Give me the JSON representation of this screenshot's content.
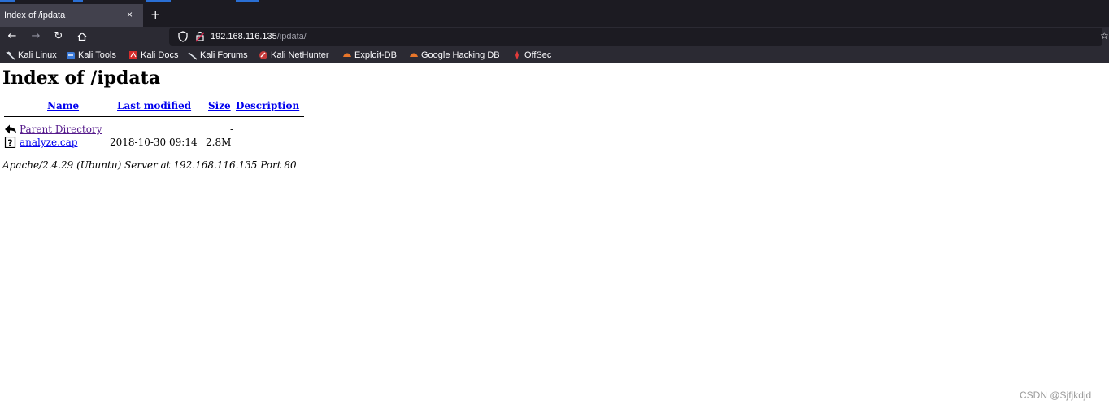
{
  "browser": {
    "tab": {
      "title": "Index of /ipdata",
      "close_glyph": "×"
    },
    "new_tab_glyph": "+",
    "nav": {
      "back": "←",
      "forward": "→",
      "reload": "↻",
      "home": "⌂"
    },
    "url": {
      "host": "192.168.116.135",
      "path": "/ipdata/"
    },
    "bookmarks": [
      {
        "label": "Kali Linux",
        "icon": "kali-dragon-icon"
      },
      {
        "label": "Kali Tools",
        "icon": "kali-tools-icon"
      },
      {
        "label": "Kali Docs",
        "icon": "kali-docs-icon"
      },
      {
        "label": "Kali Forums",
        "icon": "kali-forums-icon"
      },
      {
        "label": "Kali NetHunter",
        "icon": "nethunter-icon"
      },
      {
        "label": "Exploit-DB",
        "icon": "exploit-db-icon"
      },
      {
        "label": "Google Hacking DB",
        "icon": "ghdb-icon"
      },
      {
        "label": "OffSec",
        "icon": "offsec-icon"
      }
    ]
  },
  "page": {
    "title": "Index of /ipdata",
    "columns": {
      "name": "Name",
      "last_modified": "Last modified",
      "size": "Size",
      "description": "Description"
    },
    "rows": [
      {
        "icon": "back-arrow-icon",
        "name": "Parent Directory",
        "last_modified": "",
        "size": "-",
        "description": ""
      },
      {
        "icon": "unknown-file-icon",
        "name": "analyze.cap",
        "last_modified": "2018-10-30 09:14",
        "size": "2.8M",
        "description": ""
      }
    ],
    "address": "Apache/2.4.29 (Ubuntu) Server at 192.168.116.135 Port 80"
  },
  "watermark": "CSDN @Sjfjkdjd",
  "colors": {
    "chrome_dark": "#1c1b22",
    "chrome_mid": "#2b2a33",
    "tab_active": "#42414d",
    "link": "#0000ee",
    "visited_link": "#551a8b"
  }
}
